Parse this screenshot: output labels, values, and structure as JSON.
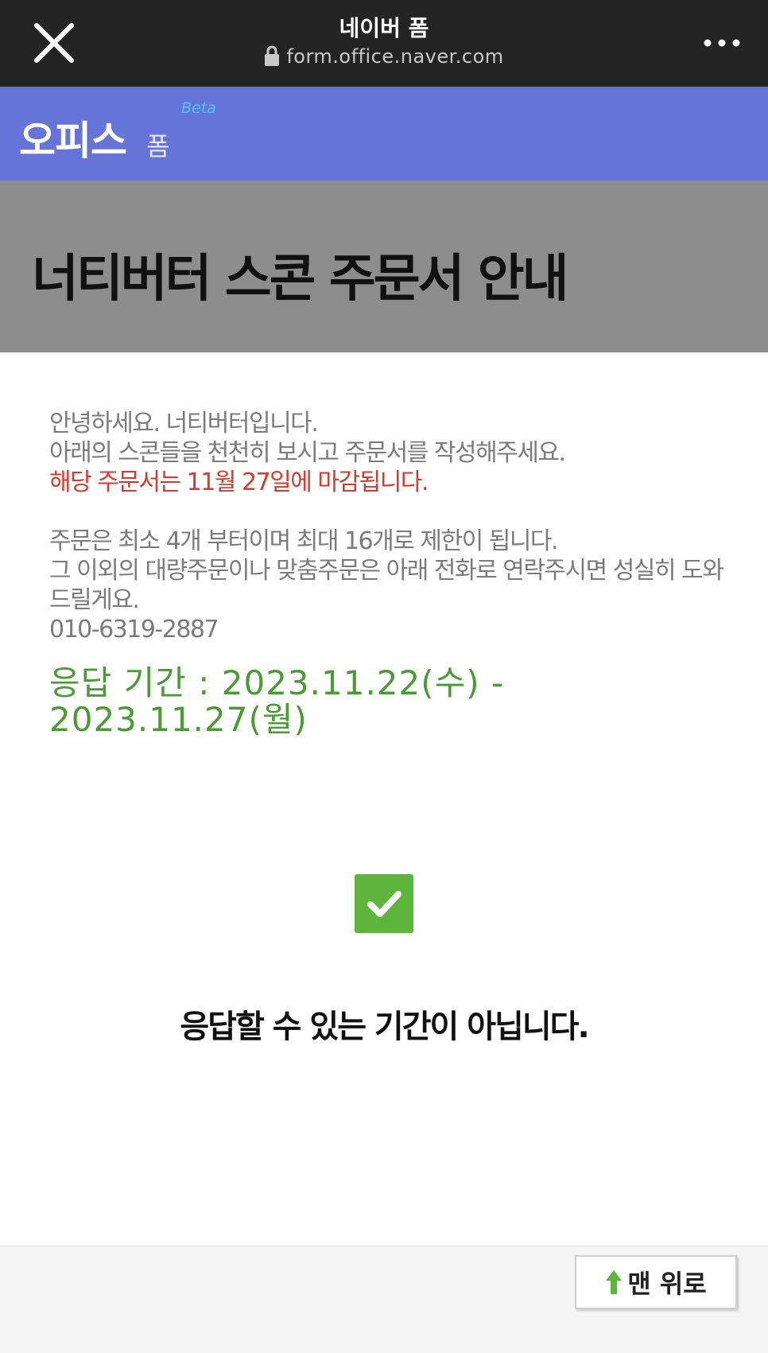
{
  "browser": {
    "site_title": "네이버 폼",
    "url": "form.office.naver.com",
    "close_icon": "close-icon",
    "more_icon": "more-dots-icon",
    "lock_icon": "lock-icon"
  },
  "brand": {
    "logo_text": "오피스",
    "product_text": "폼",
    "beta_text": "Beta",
    "color": "#6674d8"
  },
  "form": {
    "title": "너티버터 스콘 주문서 안내",
    "intro_line1": "안녕하세요. 너티버터입니다.",
    "intro_line2": "아래의 스콘들을 천천히 보시고 주문서를 작성해주세요.",
    "deadline_notice": "해당 주문서는 11월 27일에 마감됩니다.",
    "limit_line": "주문은 최소 4개 부터이며 최대 16개로 제한이 됩니다.",
    "bulk_line": "그 이외의 대량주문이나 맞춤주문은 아래 전화로 연락주시면 성실히 도와드릴게요.",
    "phone": "010-6319-2887",
    "response_period": "응답 기간 : 2023.11.22(수) - 2023.11.27(월)"
  },
  "status": {
    "icon": "check-icon",
    "message": "응답할 수 있는 기간이 아닙니다.",
    "color": "#5eb53b"
  },
  "footer": {
    "top_button_label": "맨 위로",
    "top_button_icon": "arrow-up-icon"
  }
}
